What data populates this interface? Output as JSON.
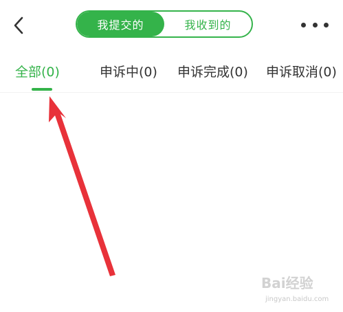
{
  "header": {
    "back_icon": "chevron-left-icon",
    "segments": [
      {
        "label": "我提交的",
        "active": true
      },
      {
        "label": "我收到的",
        "active": false
      }
    ],
    "more_icon": "more-dots-icon"
  },
  "tabs": [
    {
      "label": "全部(0)",
      "active": true
    },
    {
      "label": "申诉中(0)",
      "active": false
    },
    {
      "label": "申诉完成(0)",
      "active": false
    },
    {
      "label": "申诉取消(0)",
      "active": false
    }
  ],
  "annotation": {
    "type": "red-arrow",
    "color": "#e8323a"
  },
  "watermark": {
    "logo": "Bai经验",
    "url": "jingyan.baidu.com"
  },
  "colors": {
    "accent": "#34b34a",
    "text": "#333333",
    "arrow": "#e8323a"
  }
}
